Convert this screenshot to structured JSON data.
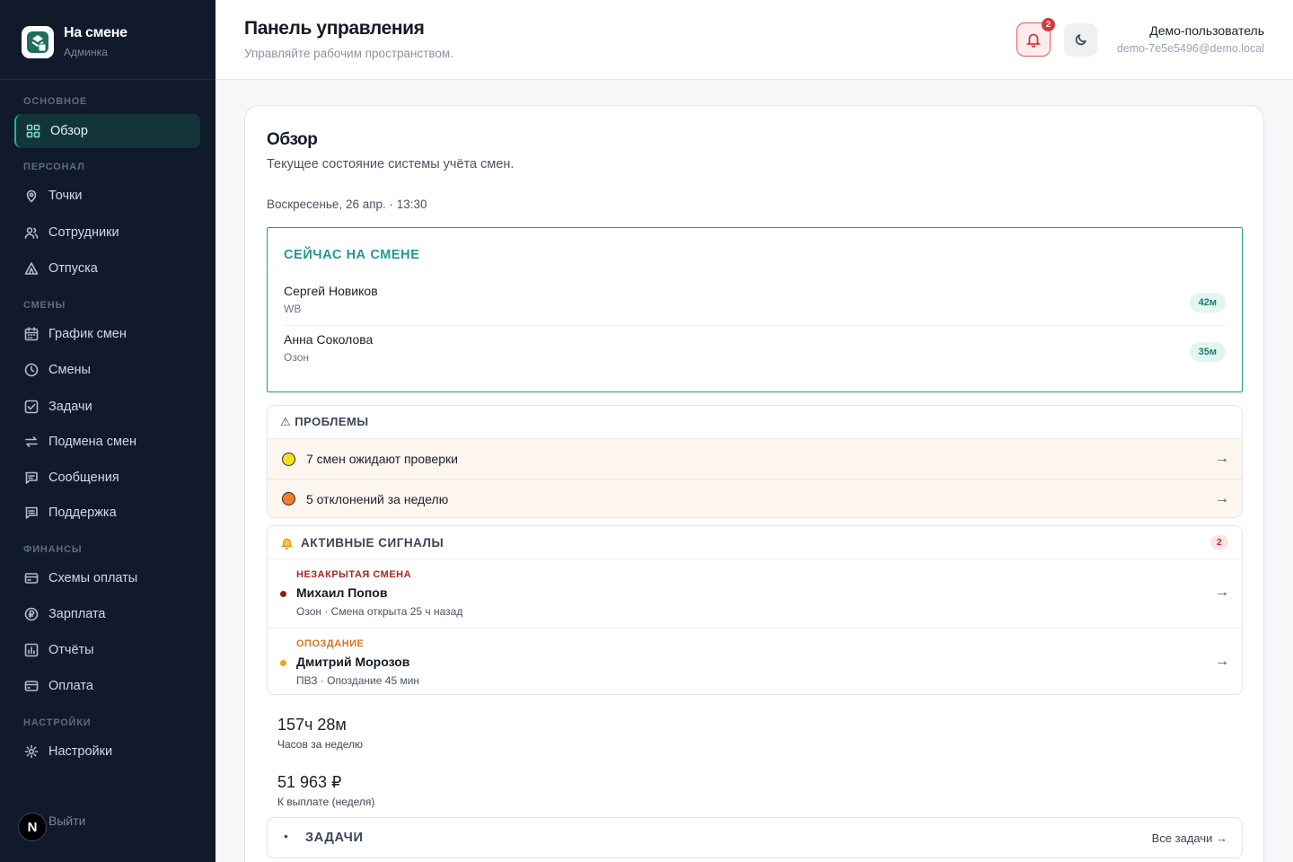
{
  "brand": {
    "title": "На смене",
    "subtitle": "Админка"
  },
  "sidebar": {
    "sections": [
      {
        "label": "ОСНОВНОЕ"
      },
      {
        "label": "ПЕРСОНАЛ"
      },
      {
        "label": "СМЕНЫ"
      },
      {
        "label": "ФИНАНСЫ"
      },
      {
        "label": "НАСТРОЙКИ"
      }
    ],
    "items": [
      {
        "label": "Обзор",
        "icon": "grid-icon",
        "active": true
      },
      {
        "label": "Точки",
        "icon": "map-pin-icon"
      },
      {
        "label": "Сотрудники",
        "icon": "users-icon"
      },
      {
        "label": "Отпуска",
        "icon": "tent-icon"
      },
      {
        "label": "График смен",
        "icon": "calendar-icon"
      },
      {
        "label": "Смены",
        "icon": "clock-icon"
      },
      {
        "label": "Задачи",
        "icon": "checkbox-icon"
      },
      {
        "label": "Подмена смен",
        "icon": "swap-icon"
      },
      {
        "label": "Сообщения",
        "icon": "message-icon"
      },
      {
        "label": "Поддержка",
        "icon": "support-icon"
      },
      {
        "label": "Схемы оплаты",
        "icon": "card-icon"
      },
      {
        "label": "Зарплата",
        "icon": "coin-icon"
      },
      {
        "label": "Отчёты",
        "icon": "chart-icon"
      },
      {
        "label": "Оплата",
        "icon": "wallet-icon"
      },
      {
        "label": "Настройки",
        "icon": "gear-icon"
      }
    ],
    "logout": "Выйти",
    "avatar_letter": "N"
  },
  "header": {
    "title": "Панель управления",
    "subtitle": "Управляйте рабочим пространством.",
    "notifications_count": "2",
    "user_name": "Демо-пользователь",
    "user_email": "demo-7e5e5496@demo.local"
  },
  "overview": {
    "title": "Обзор",
    "subtitle": "Текущее состояние системы учёта смен.",
    "date_line": "Воскресенье, 26 апр. · 13:30"
  },
  "on_shift": {
    "title": "СЕЙЧАС НА СМЕНЕ",
    "rows": [
      {
        "name": "Сергей Новиков",
        "place": "WB",
        "duration": "42м"
      },
      {
        "name": "Анна Соколова",
        "place": "Озон",
        "duration": "35м"
      }
    ]
  },
  "problems": {
    "title": "⚠ ПРОБЛЕМЫ",
    "rows": [
      {
        "text": "7 смен ожидают проверки",
        "color": "#f5e21e"
      },
      {
        "text": "5 отклонений за неделю",
        "color": "#f07e2a"
      }
    ]
  },
  "signals": {
    "title": "АКТИВНЫЕ СИГНАЛЫ",
    "count": "2",
    "rows": [
      {
        "type": "НЕЗАКРЫТАЯ СМЕНА",
        "type_color": "#a82424",
        "name": "Михаил Попов",
        "detail": "Озон · Смена открыта 25 ч назад",
        "dot_color": "#8a1f1f"
      },
      {
        "type": "ОПОЗДАНИЕ",
        "type_color": "#d8731c",
        "name": "Дмитрий Морозов",
        "detail": "ПВЗ · Опоздание 45 мин",
        "dot_color": "#f0a21e"
      }
    ]
  },
  "stats": [
    {
      "value": "157ч 28м",
      "label": "Часов за неделю"
    },
    {
      "value": "51 963 ₽",
      "label": "К выплате (неделя)"
    }
  ],
  "tasks": {
    "bullet": "•",
    "title": "ЗАДАЧИ",
    "link": "Все задачи →"
  },
  "arrow": "→"
}
